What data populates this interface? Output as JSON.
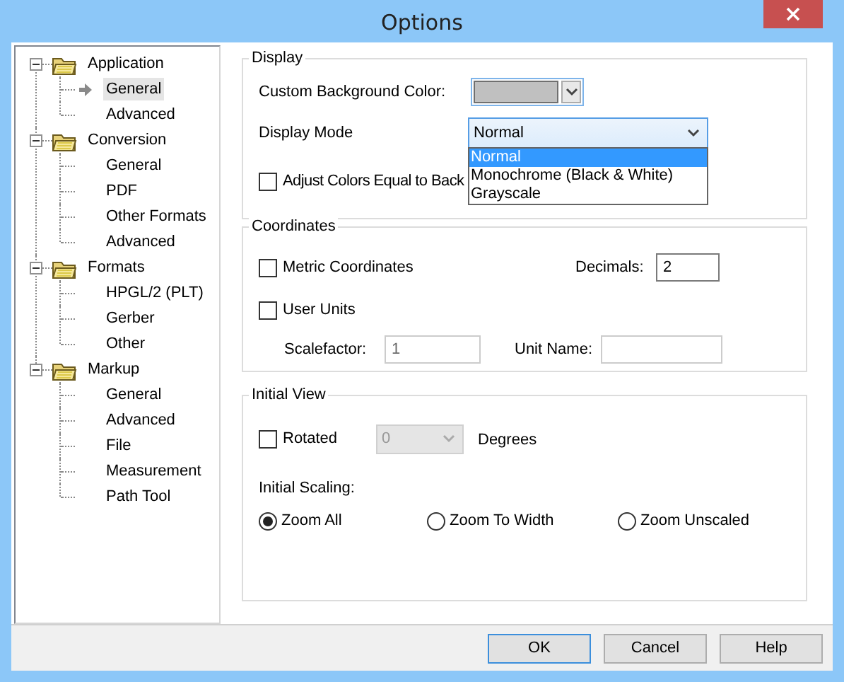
{
  "window": {
    "title": "Options"
  },
  "tree": [
    {
      "label": "Application",
      "expanded": true,
      "children": [
        {
          "label": "General",
          "selected": true
        },
        {
          "label": "Advanced",
          "selected": false
        }
      ]
    },
    {
      "label": "Conversion",
      "expanded": true,
      "children": [
        {
          "label": "General",
          "selected": false
        },
        {
          "label": "PDF",
          "selected": false
        },
        {
          "label": "Other Formats",
          "selected": false
        },
        {
          "label": "Advanced",
          "selected": false
        }
      ]
    },
    {
      "label": "Formats",
      "expanded": true,
      "children": [
        {
          "label": "HPGL/2 (PLT)",
          "selected": false
        },
        {
          "label": "Gerber",
          "selected": false
        },
        {
          "label": "Other",
          "selected": false
        }
      ]
    },
    {
      "label": "Markup",
      "expanded": true,
      "children": [
        {
          "label": "General",
          "selected": false
        },
        {
          "label": "Advanced",
          "selected": false
        },
        {
          "label": "File",
          "selected": false
        },
        {
          "label": "Measurement",
          "selected": false
        },
        {
          "label": "Path Tool",
          "selected": false
        }
      ]
    }
  ],
  "display": {
    "title": "Display",
    "background_color_label": "Custom Background Color:",
    "display_mode": {
      "label": "Display Mode",
      "value": "Normal",
      "open": true,
      "options": [
        {
          "label": "Normal",
          "selected": true
        },
        {
          "label": "Monochrome (Black & White)",
          "selected": false
        },
        {
          "label": "Grayscale",
          "selected": false
        }
      ]
    },
    "adjust_colors": {
      "label": "Adjust Colors Equal to Back",
      "checked": false
    }
  },
  "coordinates": {
    "title": "Coordinates",
    "metric": {
      "label": "Metric Coordinates",
      "checked": false
    },
    "decimals": {
      "label": "Decimals:",
      "value": "2",
      "disabled": false
    },
    "user_units": {
      "label": "User Units",
      "checked": false
    },
    "scalefactor": {
      "label": "Scalefactor:",
      "value": "1",
      "disabled": true
    },
    "unit_name": {
      "label": "Unit Name:",
      "disabled": true
    }
  },
  "initial_view": {
    "title": "Initial View",
    "rotated": {
      "label": "Rotated",
      "checked": false
    },
    "rotation": {
      "value": "0",
      "disabled": true
    },
    "degrees_label": "Degrees",
    "scaling_label": "Initial Scaling:",
    "scaling": [
      {
        "label": "Zoom All",
        "selected": true
      },
      {
        "label": "Zoom To Width",
        "selected": false
      },
      {
        "label": "Zoom Unscaled",
        "selected": false
      }
    ]
  },
  "buttons": [
    {
      "label": "OK",
      "default": true
    },
    {
      "label": "Cancel",
      "default": false
    },
    {
      "label": "Help",
      "default": false
    }
  ]
}
